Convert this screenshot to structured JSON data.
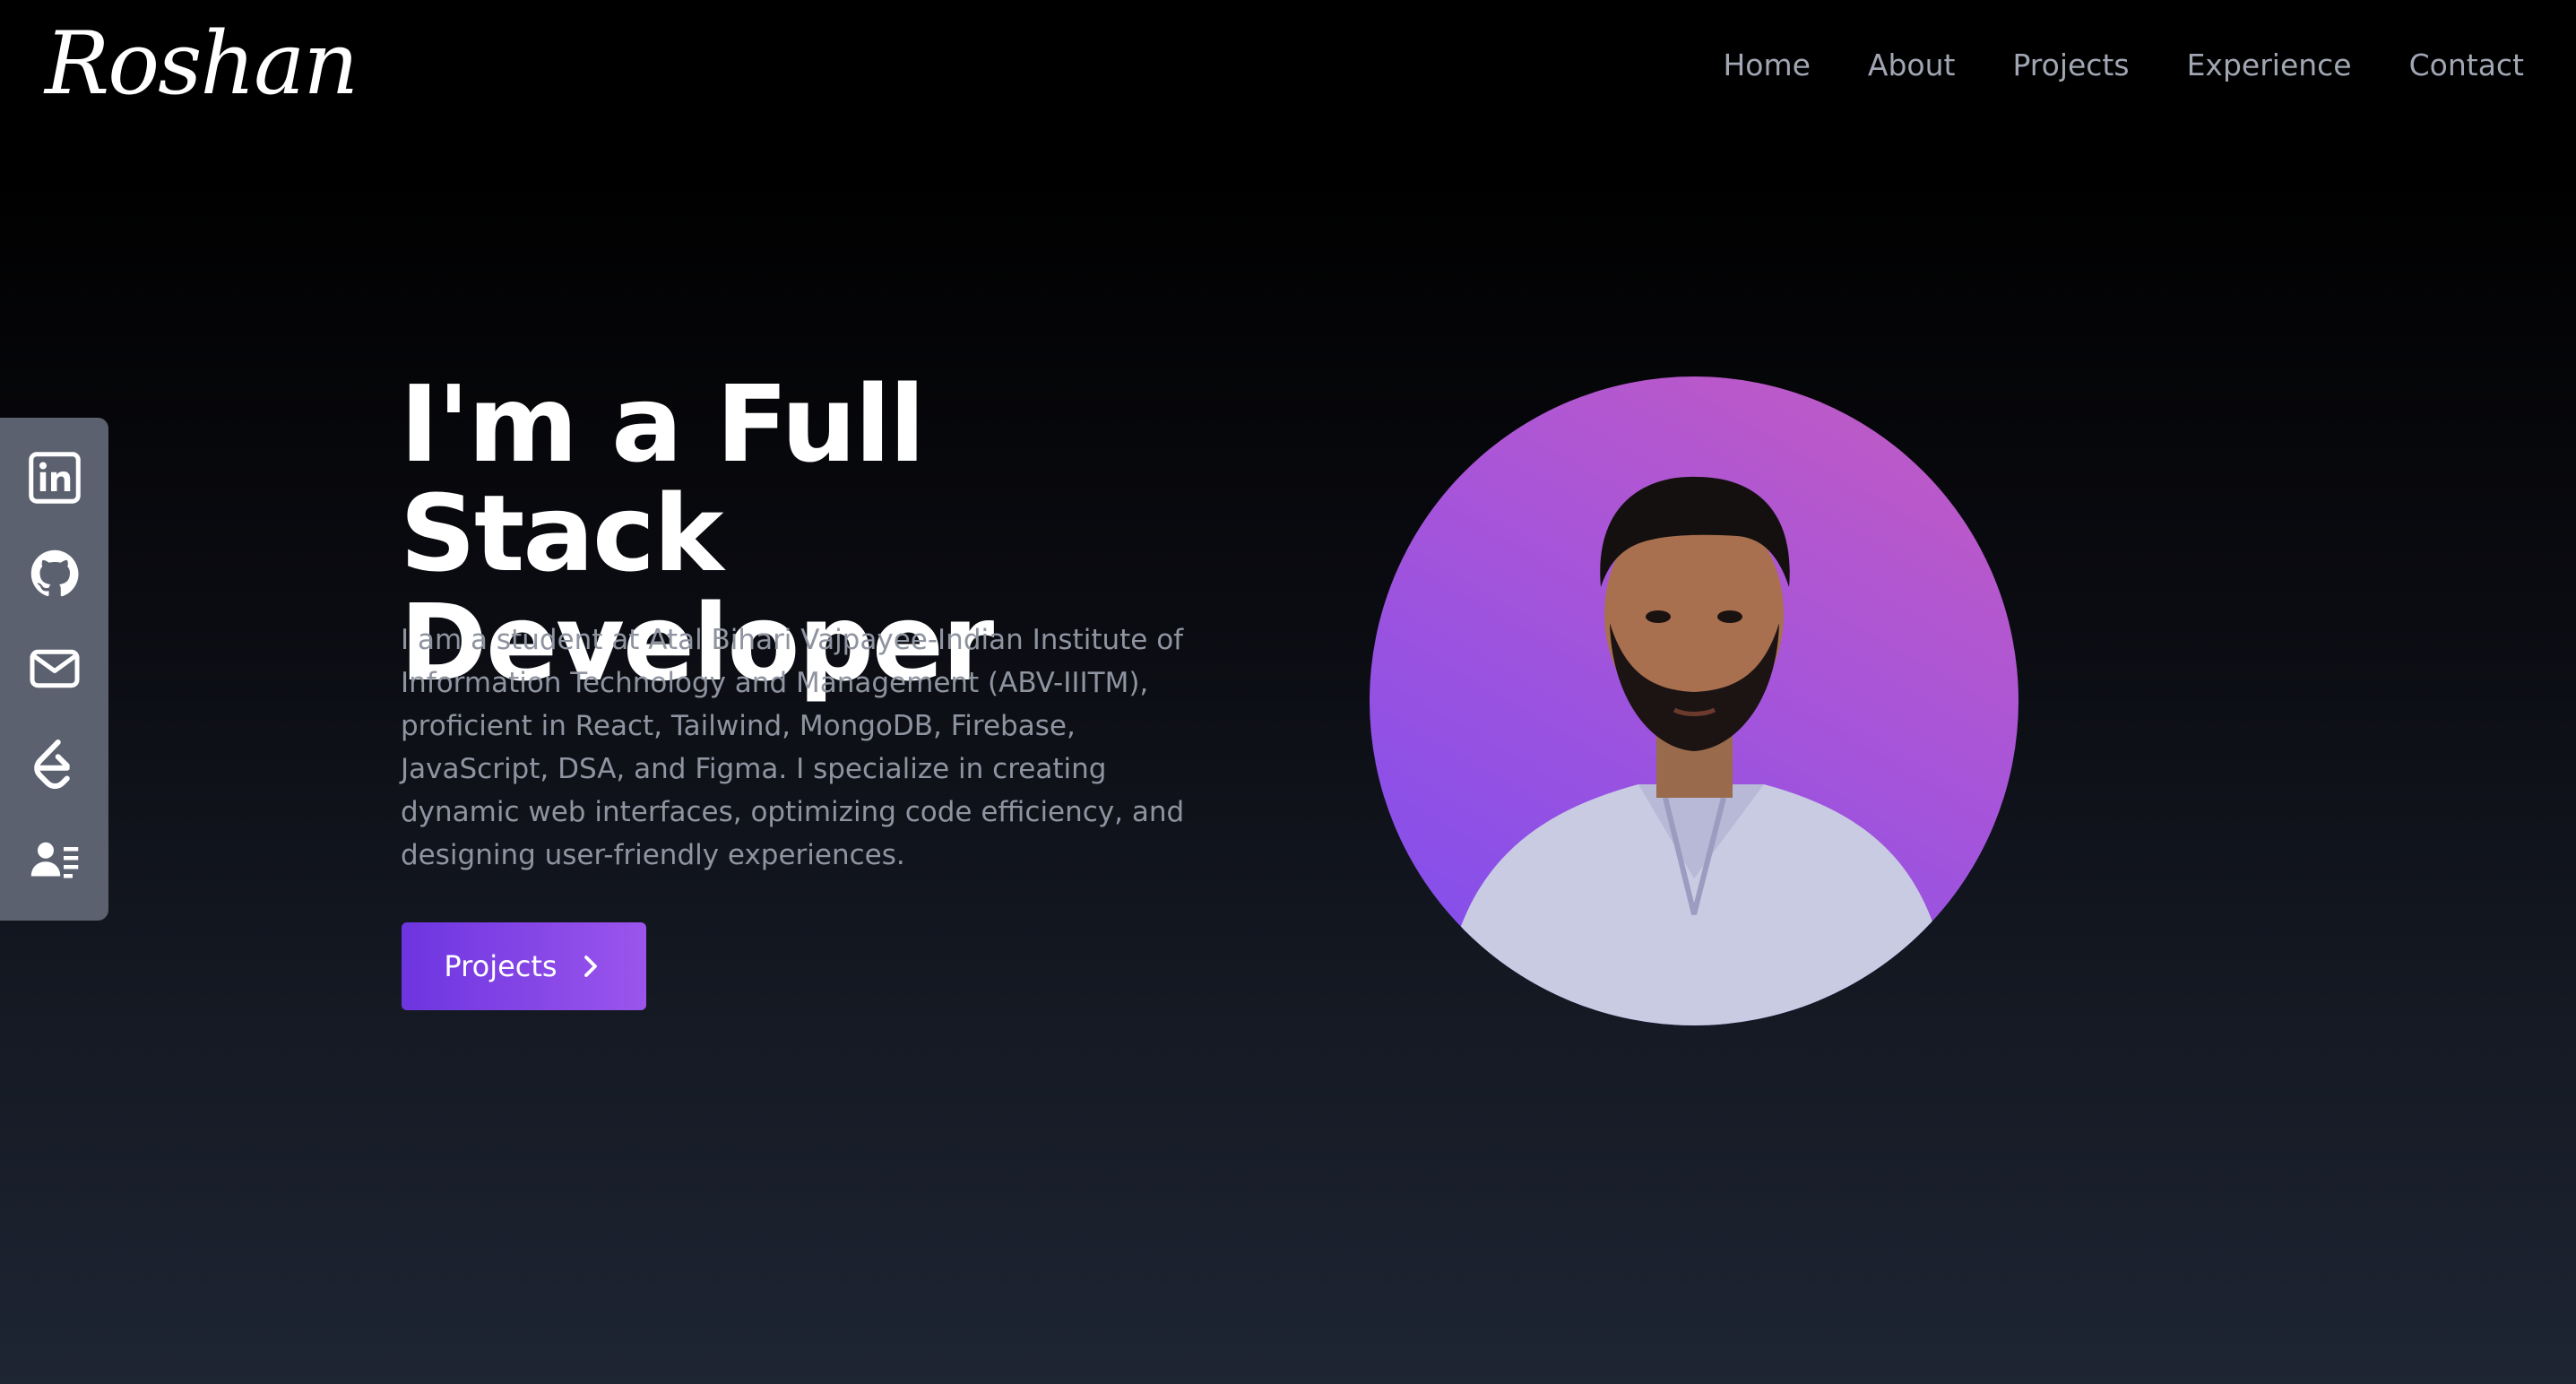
{
  "header": {
    "logo_text": "Roshan",
    "nav": [
      {
        "label": "Home"
      },
      {
        "label": "About"
      },
      {
        "label": "Projects"
      },
      {
        "label": "Experience"
      },
      {
        "label": "Contact"
      }
    ]
  },
  "social": [
    {
      "icon": "linkedin-icon"
    },
    {
      "icon": "github-icon"
    },
    {
      "icon": "mail-icon"
    },
    {
      "icon": "leetcode-icon"
    },
    {
      "icon": "resume-icon"
    }
  ],
  "hero": {
    "title_line1": "I'm a Full Stack",
    "title_line2": "Developer",
    "description": "I am a student at Atal Bihari Vajpayee-Indian Institute of Information Technology and Management (ABV-IIITM), proficient in React, Tailwind, MongoDB, Firebase, JavaScript, DSA, and Figma. I specialize in creating dynamic web interfaces, optimizing code efficiency, and designing user-friendly experiences.",
    "cta_label": "Projects",
    "cta_icon": "chevron-right-icon"
  },
  "colors": {
    "accent_start": "#6d35e0",
    "accent_end": "#9b55ec",
    "sidebar_bg": "#5c6170",
    "nav_text": "#a1a6b3",
    "desc_text": "#8f94a1"
  }
}
